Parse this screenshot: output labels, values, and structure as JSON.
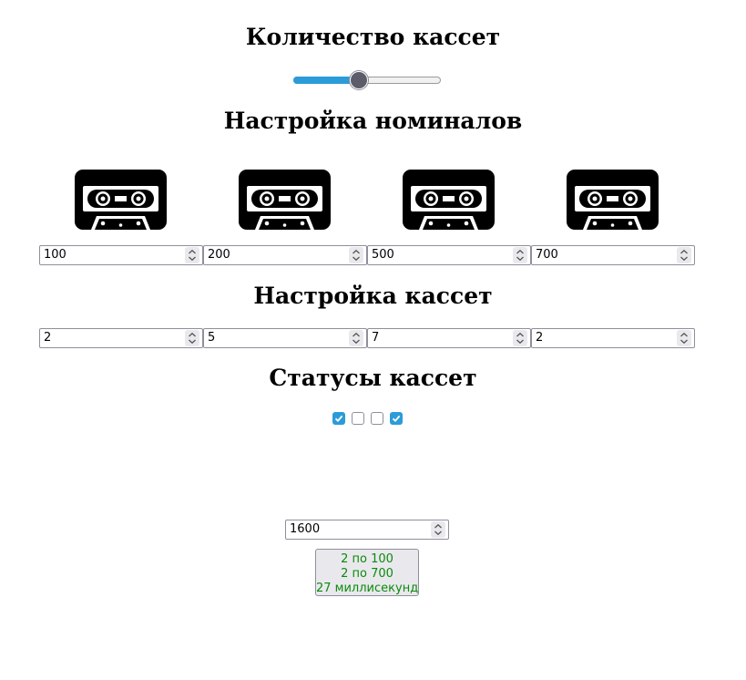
{
  "headings": {
    "cassette_count": "Количество кассет",
    "denominations": "Настройка номиналов",
    "cassettes": "Настройка кассет",
    "statuses": "Статусы кассет"
  },
  "slider": {
    "value": 4,
    "min": 1,
    "max": 8
  },
  "denominations": [
    "100",
    "200",
    "500",
    "700"
  ],
  "cassette_amounts": [
    "2",
    "5",
    "7",
    "2"
  ],
  "statuses": [
    true,
    false,
    false,
    true
  ],
  "amount_input": "1600",
  "result": {
    "line1": "2 по 100",
    "line2": "2 по 700",
    "line3": "27 миллисекунд"
  },
  "colors": {
    "accent": "#2b9cd8",
    "result_text": "#0b8a0b"
  },
  "icons": {
    "cassette": "cassette-tape-icon",
    "spinner": "spin-arrows-icon",
    "check": "checkmark-icon"
  }
}
